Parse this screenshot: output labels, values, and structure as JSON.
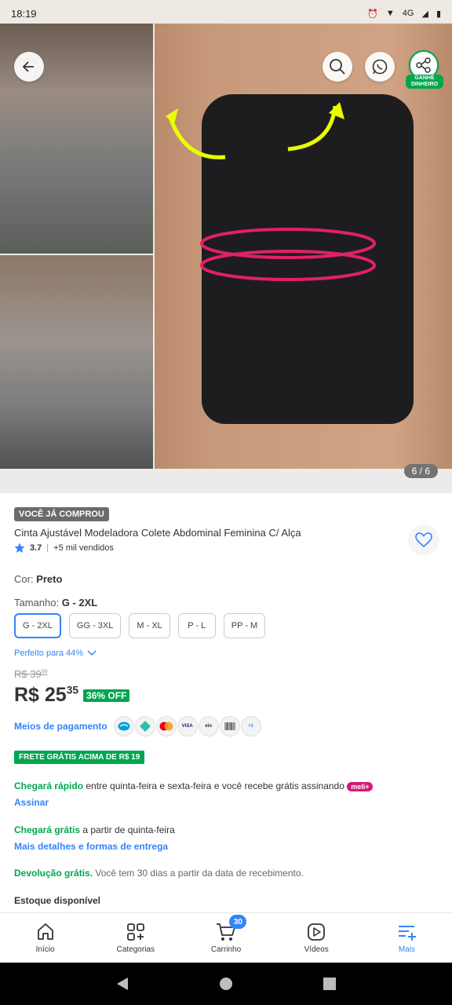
{
  "status_bar": {
    "time": "18:19",
    "network": "4G"
  },
  "gallery": {
    "counter": "6 / 6",
    "share_badge": "GANHE DINHEIRO"
  },
  "product": {
    "bought_badge": "VOCÊ JÁ COMPROU",
    "title": "Cinta Ajustável Modeladora Colete Abdominal Feminina C/ Alça",
    "rating": "3.7",
    "sold": "+5 mil vendidos",
    "color_label": "Cor:",
    "color_value": "Preto",
    "size_label": "Tamanho:",
    "size_value": "G - 2XL",
    "sizes": [
      "G - 2XL",
      "GG - 3XL",
      "M - XL",
      "P - L",
      "PP - M"
    ],
    "perfect_fit": "Perfeito para 44%",
    "old_price_int": "R$ 39",
    "old_price_cents": "99",
    "price_int": "R$ 25",
    "price_cents": "35",
    "discount": "36% OFF"
  },
  "payment": {
    "label": "Meios de pagamento",
    "icons": [
      "mercado-pago",
      "pix",
      "mastercard",
      "visa",
      "elo",
      "boleto",
      "+1"
    ]
  },
  "shipping": {
    "badge": "FRETE GRÁTIS ACIMA DE R$ 19",
    "fast_highlight": "Chegará rápido",
    "fast_text": " entre quinta-feira e sexta-feira e você recebe grátis assinando ",
    "meli_badge": "meli+",
    "subscribe_link": "Assinar",
    "free_highlight": "Chegará grátis",
    "free_text": " a partir de quinta-feira",
    "details_link": "Mais detalhes e formas de entrega",
    "return_highlight": "Devolução grátis.",
    "return_text": " Você tem 30 dias a partir da data de recebimento.",
    "stock": "Estoque disponível"
  },
  "bottom_nav": {
    "items": [
      "Início",
      "Categorias",
      "Carrinho",
      "Vídeos",
      "Mais"
    ],
    "cart_count": "30"
  },
  "colors": {
    "accent": "#3483fa",
    "green": "#00a650",
    "meli_pink": "#d51977"
  }
}
